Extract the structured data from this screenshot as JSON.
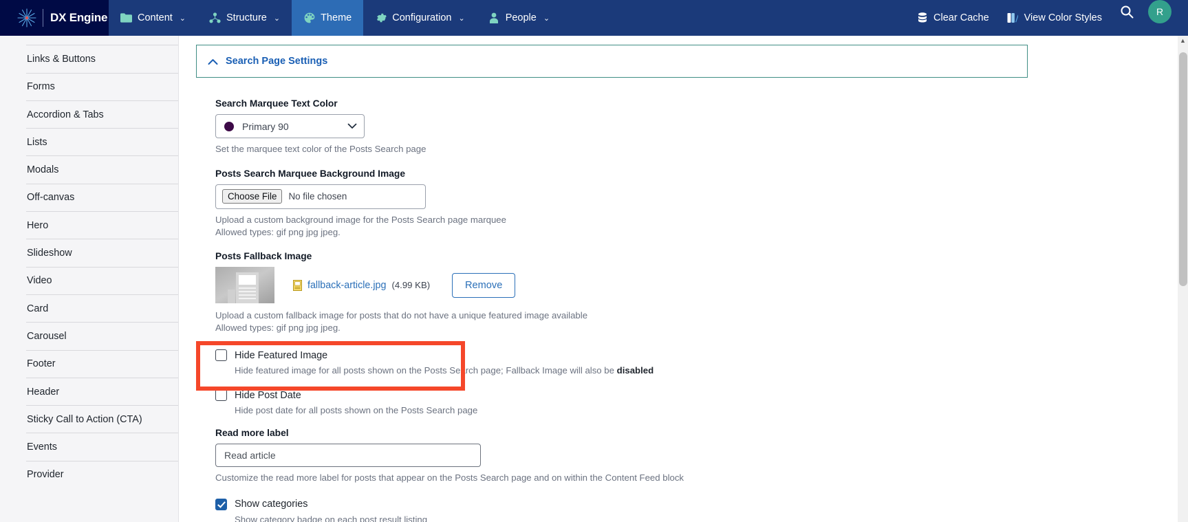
{
  "topnav": {
    "brand": "DX Engine",
    "brand_logo_icon": "starburst-logo-icon",
    "items": [
      {
        "label": "Content",
        "icon": "folder-icon",
        "caret": "⌄",
        "active": false
      },
      {
        "label": "Structure",
        "icon": "structure-nodes-icon",
        "caret": "⌄",
        "active": false
      },
      {
        "label": "Theme",
        "icon": "palette-icon",
        "caret": "",
        "active": true
      },
      {
        "label": "Configuration",
        "icon": "gear-icon",
        "caret": "⌄",
        "active": false
      },
      {
        "label": "People",
        "icon": "person-icon",
        "caret": "⌄",
        "active": false
      }
    ],
    "right_items": [
      {
        "label": "Clear Cache",
        "icon": "database-icon"
      },
      {
        "label": "View Color Styles",
        "icon": "color-swatches-icon"
      }
    ],
    "search_icon": "search-icon",
    "avatar_initial": "R",
    "colors": {
      "nav_background": "#1b3a7a",
      "brand_background": "#000a45",
      "active_tab": "#2d6cb5",
      "nav_icon": "#7fd4c1",
      "avatar_background": "#33a08c"
    }
  },
  "sidebar": {
    "items": [
      {
        "label": "Links & Buttons"
      },
      {
        "label": "Forms"
      },
      {
        "label": "Accordion & Tabs"
      },
      {
        "label": "Lists"
      },
      {
        "label": "Modals"
      },
      {
        "label": "Off-canvas"
      },
      {
        "label": "Hero"
      },
      {
        "label": "Slideshow"
      },
      {
        "label": "Video"
      },
      {
        "label": "Card"
      },
      {
        "label": "Carousel"
      },
      {
        "label": "Footer"
      },
      {
        "label": "Header"
      },
      {
        "label": "Sticky Call to Action (CTA)"
      },
      {
        "label": "Events"
      },
      {
        "label": "Provider"
      }
    ]
  },
  "panel": {
    "title": "Search Page Settings",
    "collapse_icon": "chevron-up-icon",
    "border_color": "#3f8d84",
    "title_color": "#1a5fb4"
  },
  "form": {
    "marquee_color": {
      "label": "Search Marquee Text Color",
      "value": "Primary 90",
      "swatch_color": "#3d0a47",
      "help": "Set the marquee text color of the Posts Search page"
    },
    "marquee_bg_image": {
      "label": "Posts Search Marquee Background Image",
      "choose_button": "Choose File",
      "no_file_text": "No file chosen",
      "help_line1": "Upload a custom background image for the Posts Search page marquee",
      "help_line2": "Allowed types: gif png jpg jpeg."
    },
    "fallback_image": {
      "label": "Posts Fallback Image",
      "file_name": "fallback-article.jpg",
      "file_size": "(4.99 KB)",
      "remove_button": "Remove",
      "file_icon": "file-image-icon",
      "help_line1": "Upload a custom fallback image for posts that do not have a unique featured image available",
      "help_line2": "Allowed types: gif png jpg jpeg."
    },
    "hide_featured_image": {
      "label": "Hide Featured Image",
      "checked": false,
      "help_prefix": "Hide featured image for all posts shown on the Posts Search page; Fallback Image will also be ",
      "help_bold": "disabled"
    },
    "hide_post_date": {
      "label": "Hide Post Date",
      "checked": false,
      "help": "Hide post date for all posts shown on the Posts Search page",
      "highlight_color": "#f5472a"
    },
    "read_more_label": {
      "label": "Read more label",
      "value": "Read article",
      "help": "Customize the read more label for posts that appear on the Posts Search page and on within the Content Feed block"
    },
    "show_categories": {
      "label": "Show categories",
      "checked": true,
      "help": "Show category badge on each post result listing"
    }
  }
}
